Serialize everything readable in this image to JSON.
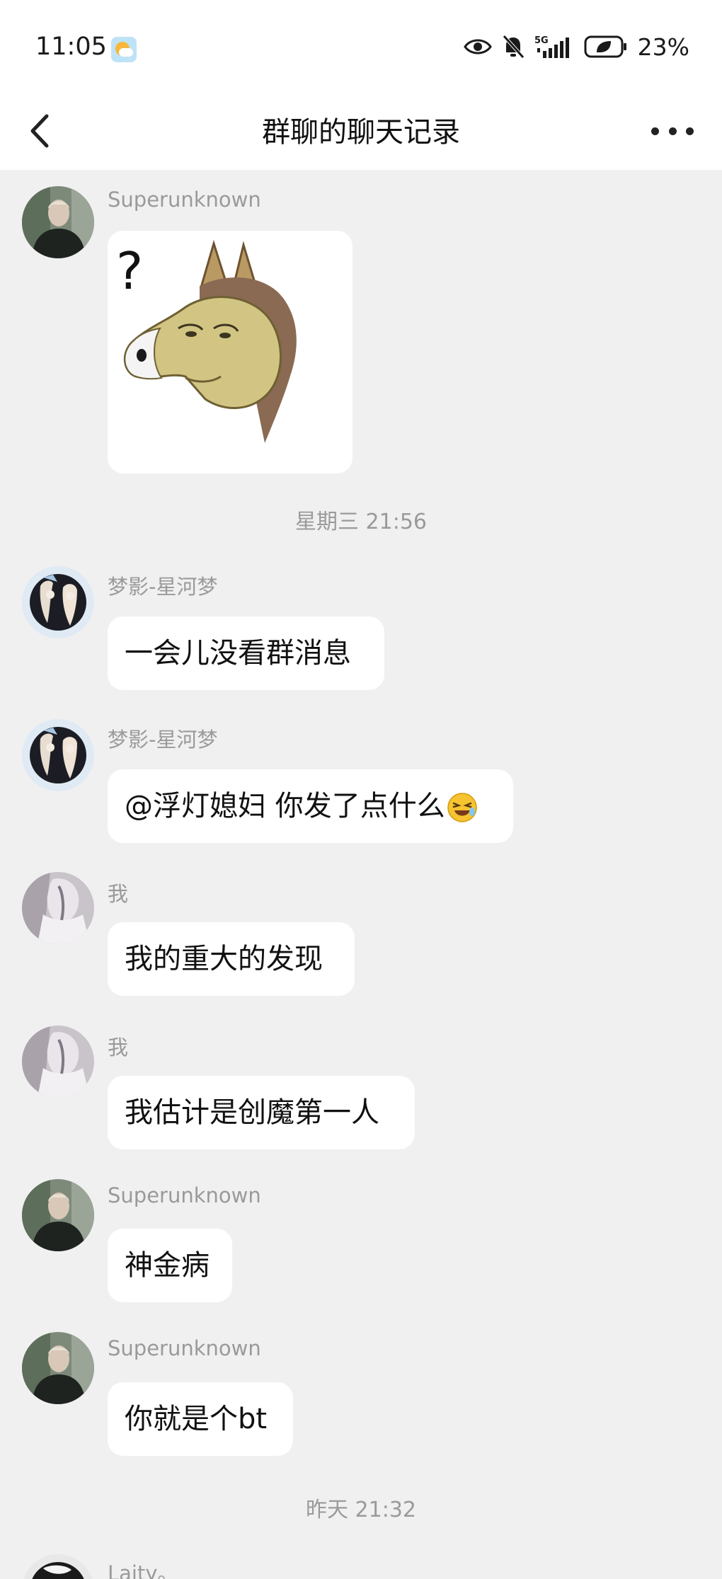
{
  "status_bar": {
    "time": "11:05",
    "weather_icon": "partly-cloudy-icon",
    "network": "5G",
    "battery_percent": "23%"
  },
  "nav": {
    "title": "群聊的聊天记录",
    "back_icon": "chevron-left-icon",
    "more_icon": "more-dots-icon"
  },
  "messages": [
    {
      "sender": "Superunknown",
      "type": "sticker",
      "sticker_text": "?"
    },
    {
      "timestamp": "星期三 21:56"
    },
    {
      "sender": "梦影-星河梦",
      "text": "一会儿没看群消息"
    },
    {
      "sender": "梦影-星河梦",
      "text": "@浮灯媳妇 你发了点什么"
    },
    {
      "sender": "我",
      "text": "我的重大的发现"
    },
    {
      "sender": "我",
      "text": "我估计是创魔第一人"
    },
    {
      "sender": "Superunknown",
      "text": "神金病"
    },
    {
      "sender": "Superunknown",
      "text": "你就是个bt"
    },
    {
      "timestamp": "昨天 21:32"
    },
    {
      "sender": "Laity。"
    }
  ],
  "colors": {
    "background": "#f0f0f0",
    "bubble": "#ffffff",
    "meta_text": "#9a9a9a"
  }
}
